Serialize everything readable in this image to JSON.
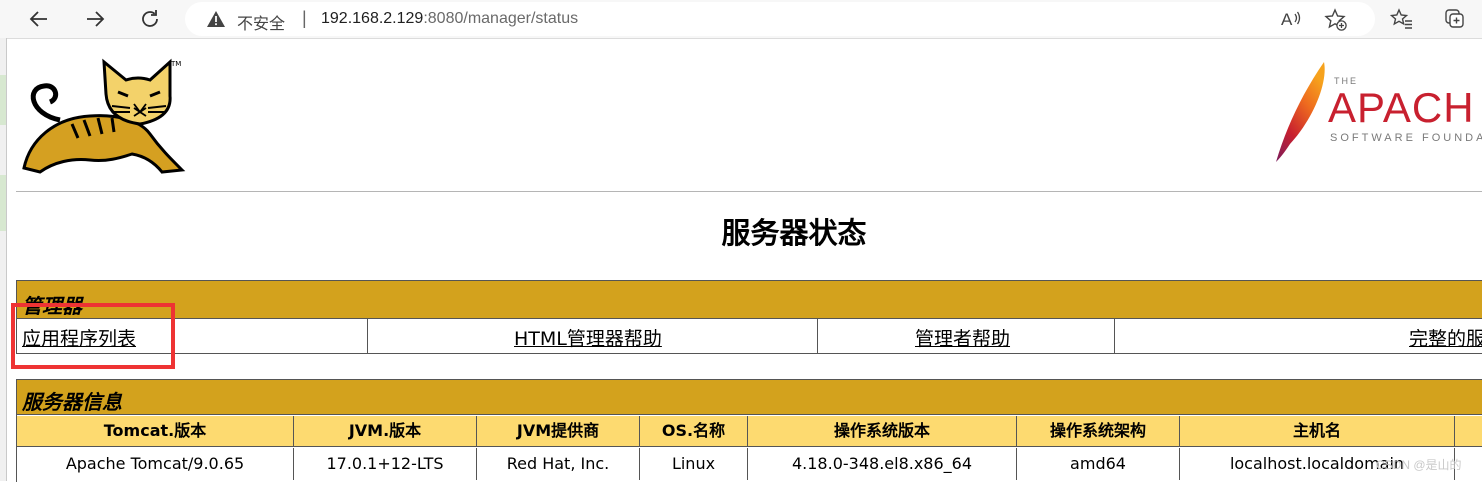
{
  "browser": {
    "security_label": "不安全",
    "separator": "|",
    "url_host": "192.168.2.129",
    "url_path": ":8080/manager/status"
  },
  "logos": {
    "tomcat_tm": "TM",
    "apache_the": "THE",
    "apache_name": "APACH",
    "apache_foundation": "SOFTWARE FOUNDA"
  },
  "page": {
    "title": "服务器状态"
  },
  "manager": {
    "heading": "管理器",
    "links": [
      {
        "label": "应用程序列表"
      },
      {
        "label": "HTML管理器帮助"
      },
      {
        "label": "管理者帮助"
      },
      {
        "label": "完整的服"
      }
    ]
  },
  "server_info": {
    "heading": "服务器信息",
    "columns": [
      "Tomcat.版本",
      "JVM.版本",
      "JVM提供商",
      "OS.名称",
      "操作系统版本",
      "操作系统架构",
      "主机名"
    ],
    "values": [
      "Apache Tomcat/9.0.65",
      "17.0.1+12-LTS",
      "Red Hat, Inc.",
      "Linux",
      "4.18.0-348.el8.x86_64",
      "amd64",
      "localhost.localdomain"
    ]
  },
  "watermark": "CSDN @是山的",
  "colors": {
    "header_gold": "#d3a21d",
    "column_header_yellow": "#fdda70",
    "highlight_red": "#ee3333"
  }
}
